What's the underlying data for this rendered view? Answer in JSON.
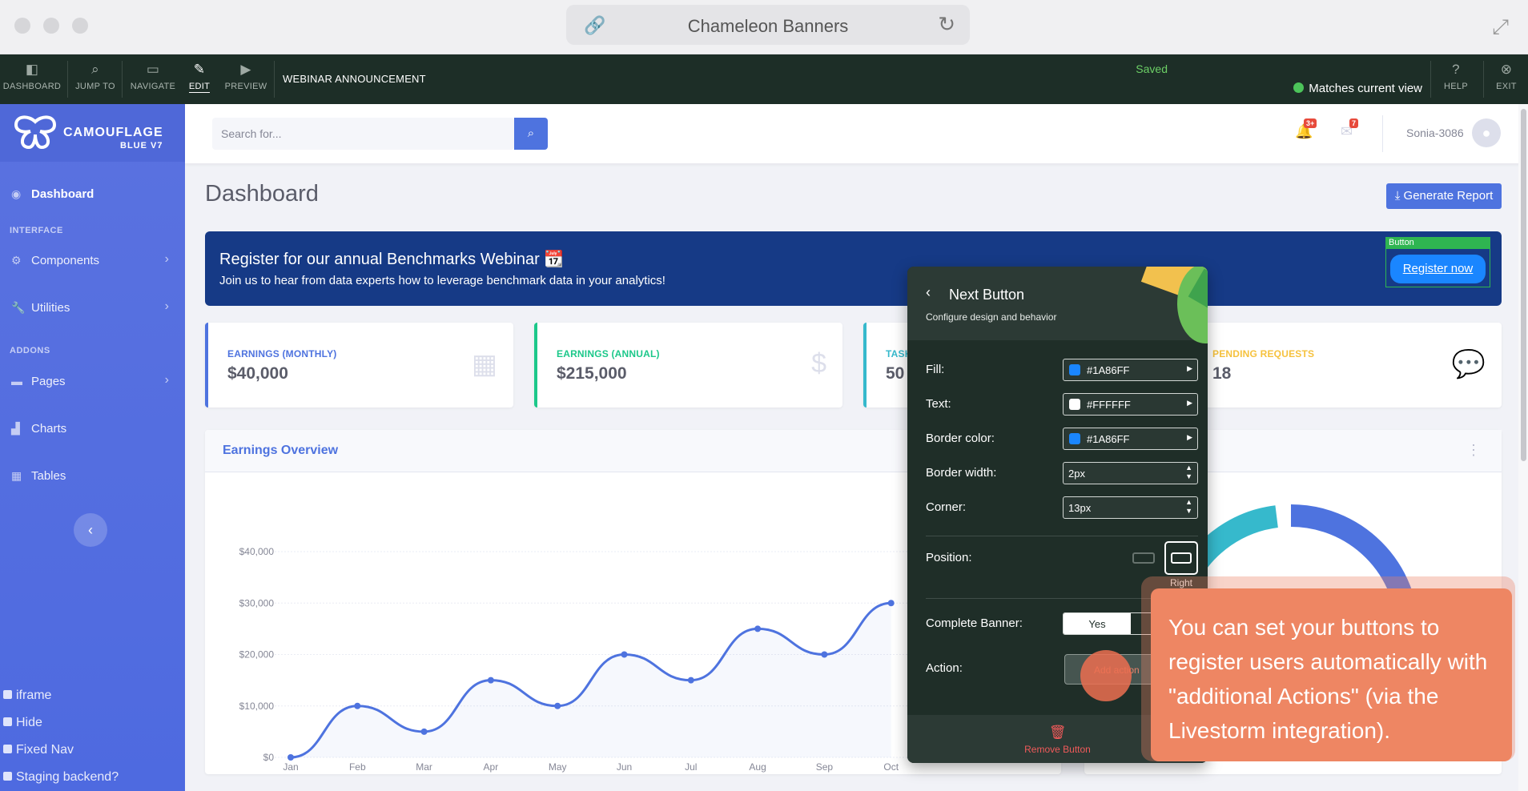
{
  "browser": {
    "title": "Chameleon Banners"
  },
  "toolbar": {
    "items": [
      {
        "label": "DASHBOARD",
        "icon": "dashboard-icon"
      },
      {
        "label": "JUMP TO",
        "icon": "search-icon"
      },
      {
        "label": "NAVIGATE",
        "icon": "navigate-icon"
      },
      {
        "label": "EDIT",
        "icon": "edit-icon"
      },
      {
        "label": "PREVIEW",
        "icon": "preview-icon"
      }
    ],
    "banner_name": "WEBINAR ANNOUNCEMENT",
    "status": "Saved",
    "matches": "Matches current view",
    "help": "HELP",
    "exit": "EXIT"
  },
  "sidebar": {
    "brand_line1": "CAMOUFLAGE",
    "brand_line2": "BLUE V7",
    "dashboard": "Dashboard",
    "heading_interface": "INTERFACE",
    "components": "Components",
    "utilities": "Utilities",
    "heading_addons": "ADDONS",
    "pages": "Pages",
    "charts": "Charts",
    "tables": "Tables",
    "dev_options": [
      "iframe",
      "Hide",
      "Fixed Nav",
      "Staging backend?"
    ]
  },
  "topbar": {
    "search_placeholder": "Search for...",
    "alerts_badge": "3+",
    "messages_badge": "7",
    "user": "Sonia-3086"
  },
  "main": {
    "title": "Dashboard",
    "generate_report": "Generate Report",
    "banner_headline": "Register for our annual Benchmarks Webinar 📆",
    "banner_sub": "Join us to hear from data experts how to leverage benchmark data in your analytics!",
    "button_tag": "Button",
    "register_label": "Register now",
    "cards": [
      {
        "label": "EARNINGS (MONTHLY)",
        "value": "$40,000",
        "color": "#4e73df"
      },
      {
        "label": "EARNINGS (ANNUAL)",
        "value": "$215,000",
        "color": "#1cc88a"
      },
      {
        "label": "TASK",
        "value": "50",
        "color": "#36b9cc"
      },
      {
        "label": "PENDING REQUESTS",
        "value": "18",
        "color": "#f6c23e"
      }
    ],
    "chart_title": "Earnings Overview"
  },
  "chart_data": {
    "type": "area",
    "title": "Earnings Overview",
    "categories": [
      "Jan",
      "Feb",
      "Mar",
      "Apr",
      "May",
      "Jun",
      "Jul",
      "Aug",
      "Sep",
      "Oct"
    ],
    "values": [
      0,
      10000,
      5000,
      15000,
      10000,
      20000,
      15000,
      25000,
      20000,
      30000
    ],
    "yticks": [
      "$0",
      "$10,000",
      "$20,000",
      "$30,000",
      "$40,000"
    ],
    "ylim": [
      0,
      40000
    ],
    "grid": true,
    "color": "#4e73df"
  },
  "editor": {
    "title": "Next Button",
    "subtitle": "Configure design and behavior",
    "fill_label": "Fill:",
    "fill_value": "#1A86FF",
    "text_label": "Text:",
    "text_value": "#FFFFFF",
    "border_color_label": "Border color:",
    "border_color_value": "#1A86FF",
    "border_width_label": "Border width:",
    "border_width_value": "2px",
    "corner_label": "Corner:",
    "corner_value": "13px",
    "position_label": "Position:",
    "position_value": "Right",
    "complete_label": "Complete Banner:",
    "complete_value": "Yes",
    "action_label": "Action:",
    "add_action": "Add action",
    "remove": "Remove Button"
  },
  "tooltip": {
    "text": "You can set your buttons to register users automatically with \"additional Actions\" (via the Livestorm integration)."
  }
}
